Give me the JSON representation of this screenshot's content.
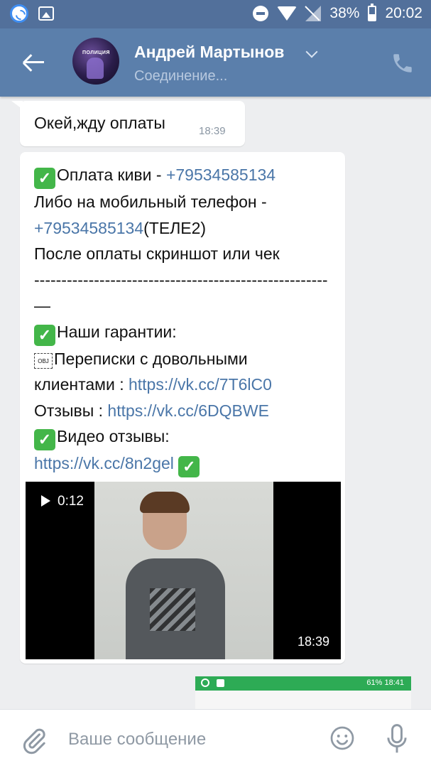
{
  "status_bar": {
    "battery": "38%",
    "time": "20:02"
  },
  "header": {
    "contact_name": "Андрей Мартынов",
    "status": "Соединение...",
    "avatar_text": "ПОЛИЦИЯ"
  },
  "messages": {
    "first": {
      "text": "Окей,жду оплаты",
      "time": "18:39"
    },
    "second": {
      "line1_text": "Оплата киви - ",
      "line1_link": "+79534585134",
      "line2": "Либо на мобильный телефон -",
      "line3_link": "+79534585134",
      "line3_text": "(ТЕЛЕ2)",
      "line4": "После оплаты скриншот или чек",
      "line5": "------------------------------------------------------",
      "line6": "—",
      "line7": "Наши гарантии:",
      "obj_glyph": "OBJ",
      "line8": "Переписки с довольными",
      "line9_text": "клиентами : ",
      "line9_link": "https://vk.cc/7T6lC0",
      "line10_text": "Отзывы : ",
      "line10_link": "https://vk.cc/6DQBWE",
      "line11": "Видео отзывы:",
      "line12_link": "https://vk.cc/8n2gel",
      "check_glyph": "✓"
    },
    "video": {
      "duration": "0:12",
      "time": "18:39"
    },
    "screenshot_preview": {
      "status_text": "61%  18:41"
    }
  },
  "composer": {
    "placeholder": "Ваше сообщение"
  },
  "colors": {
    "header": "#5b7fab",
    "status_bar": "#52709b",
    "link": "#4a76a8",
    "check": "#43b649"
  }
}
